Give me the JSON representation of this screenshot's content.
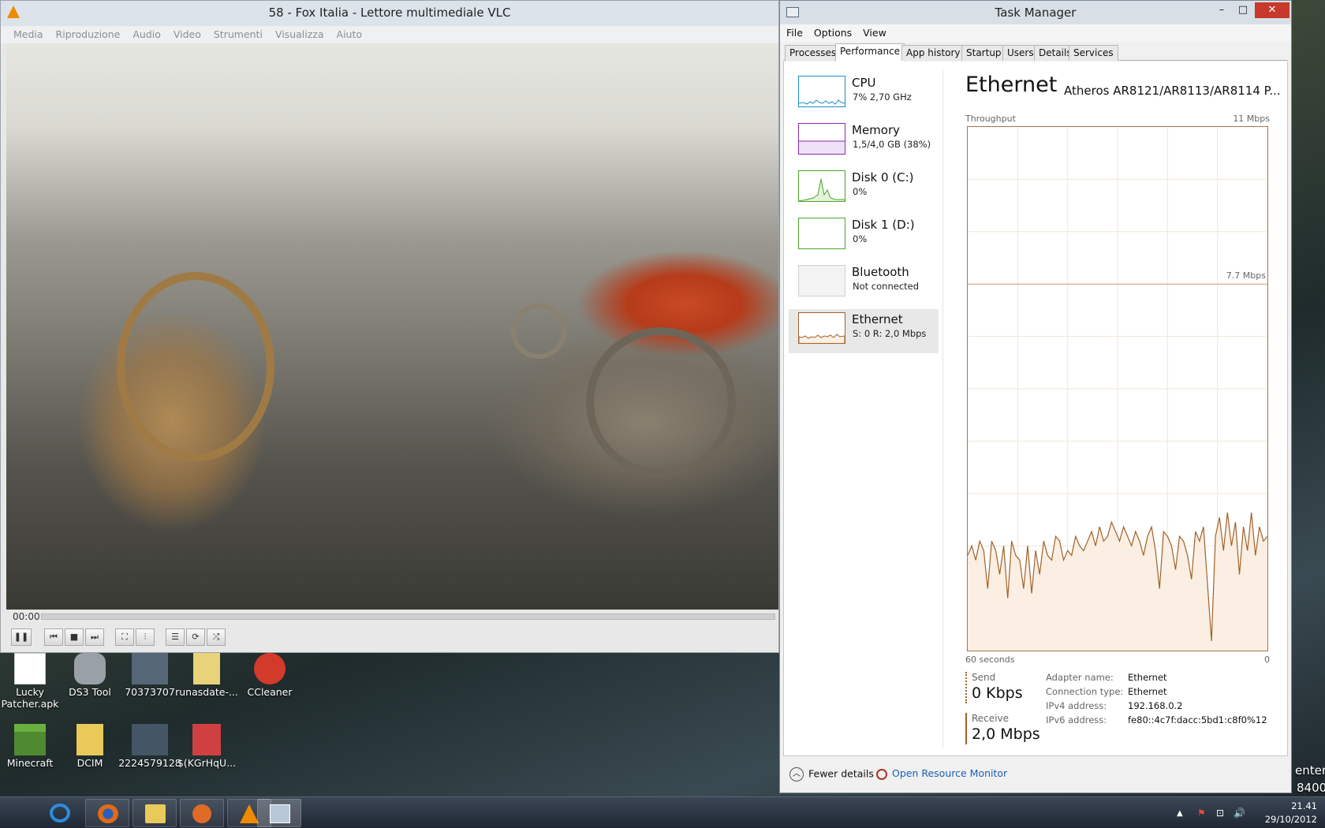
{
  "vlc": {
    "title": "58 -  Fox Italia - Lettore multimediale VLC",
    "menu": [
      "Media",
      "Riproduzione",
      "Audio",
      "Video",
      "Strumenti",
      "Visualizza",
      "Aiuto"
    ],
    "time": "00:00",
    "progress": 0,
    "controls": [
      {
        "name": "pause",
        "glyph": "❚❚"
      },
      {
        "name": "previous",
        "glyph": "⏮"
      },
      {
        "name": "stop",
        "glyph": "■"
      },
      {
        "name": "next",
        "glyph": "⏭"
      },
      {
        "name": "fullscreen",
        "glyph": "⛶"
      },
      {
        "name": "extended-settings",
        "glyph": "⫶"
      },
      {
        "name": "playlist",
        "glyph": "☰"
      },
      {
        "name": "loop",
        "glyph": "⟳"
      },
      {
        "name": "shuffle",
        "glyph": "⤮"
      }
    ]
  },
  "taskmanager": {
    "title": "Task Manager",
    "window_buttons": {
      "minimize": "–",
      "maximize": "□",
      "close": "✕"
    },
    "menu": [
      "File",
      "Options",
      "View"
    ],
    "tabs": [
      "Processes",
      "Performance",
      "App history",
      "Startup",
      "Users",
      "Details",
      "Services"
    ],
    "active_tab": "Performance",
    "sidebar": [
      {
        "name": "CPU",
        "sub": "7%  2,70 GHz",
        "color": "#1c8ec8"
      },
      {
        "name": "Memory",
        "sub": "1,5/4,0 GB (38%)",
        "color": "#8b2ab0"
      },
      {
        "name": "Disk 0 (C:)",
        "sub": "0%",
        "color": "#4da62c"
      },
      {
        "name": "Disk 1 (D:)",
        "sub": "0%",
        "color": "#4da62c"
      },
      {
        "name": "Bluetooth",
        "sub": "Not connected",
        "color": "#aaaaaa"
      },
      {
        "name": "Ethernet",
        "sub": "S: 0  R: 2,0 Mbps",
        "color": "#a0622a"
      }
    ],
    "selected": "Ethernet",
    "detail": {
      "title": "Ethernet",
      "adapter": "Atheros AR8121/AR8113/AR8114 P...",
      "throughput_label": "Throughput",
      "max_label": "11 Mbps",
      "mid_label": "7.7 Mbps",
      "time_left": "60 seconds",
      "time_right": "0",
      "send_label": "Send",
      "send_value": "0 Kbps",
      "receive_label": "Receive",
      "receive_value": "2,0 Mbps",
      "info": [
        {
          "k": "Adapter name:",
          "v": "Ethernet"
        },
        {
          "k": "Connection type:",
          "v": "Ethernet"
        },
        {
          "k": "IPv4 address:",
          "v": "192.168.0.2"
        },
        {
          "k": "IPv6 address:",
          "v": "fe80::4c7f:dacc:5bd1:c8f0%12"
        }
      ]
    },
    "graph": {
      "ymax": 11,
      "color": "#a0622a",
      "fill": "#fbeee2",
      "receive_mbps": [
        2.0,
        2.2,
        1.9,
        2.3,
        2.1,
        1.3,
        2.3,
        2.1,
        1.6,
        2.2,
        1.1,
        2.3,
        2.0,
        1.9,
        1.3,
        2.2,
        1.2,
        2.1,
        1.6,
        2.3,
        2.0,
        1.9,
        2.4,
        2.3,
        1.9,
        2.1,
        2.0,
        2.4,
        2.2,
        2.1,
        2.3,
        2.5,
        2.2,
        2.6,
        2.3,
        2.4,
        2.7,
        2.5,
        2.3,
        2.6,
        2.4,
        2.2,
        2.5,
        2.3,
        2.0,
        2.4,
        2.6,
        2.1,
        1.3,
        2.5,
        2.4,
        2.2,
        1.7,
        2.4,
        2.3,
        2.0,
        1.5,
        2.5,
        2.3,
        2.6,
        1.4,
        0.2,
        2.4,
        2.8,
        2.1,
        2.9,
        2.2,
        2.7,
        1.6,
        2.6,
        2.1,
        2.9,
        2.0,
        2.6,
        2.3,
        2.4
      ]
    },
    "footer": {
      "fewer": "Fewer details",
      "resource_monitor": "Open Resource Monitor"
    }
  },
  "desktop_icons": [
    {
      "label": "Lucky Patcher.apk",
      "icon": "document-icon",
      "color": "#ffffff"
    },
    {
      "label": "DS3 Tool",
      "icon": "gamepad-icon",
      "color": "#9aa0a8"
    },
    {
      "label": "70373707",
      "icon": "image-icon",
      "color": "#556677"
    },
    {
      "label": "runasdate-...",
      "icon": "archive-icon",
      "color": "#e8d27a"
    },
    {
      "label": "CCleaner",
      "icon": "ccleaner-icon",
      "color": "#d23a2a"
    },
    {
      "label": "Minecraft",
      "icon": "minecraft-icon",
      "color": "#4f8a30"
    },
    {
      "label": "DCIM",
      "icon": "folder-icon",
      "color": "#e8c95a"
    },
    {
      "label": "2224579128",
      "icon": "image-icon",
      "color": "#445566"
    },
    {
      "label": "$(KGrHqU...",
      "icon": "document-icon",
      "color": "#d04040"
    }
  ],
  "edge_text": [
    "enter",
    "8400"
  ],
  "taskbar": {
    "buttons": [
      {
        "name": "internet-explorer",
        "icon": "ie-icon",
        "color": "#2a8de0"
      },
      {
        "name": "firefox",
        "icon": "firefox-icon",
        "color": "#e06a1a"
      },
      {
        "name": "explorer",
        "icon": "folder-icon",
        "color": "#e8c95a"
      },
      {
        "name": "app-orange",
        "icon": "pin-icon",
        "color": "#e06a28"
      },
      {
        "name": "vlc",
        "icon": "vlc-icon",
        "color": "#f08a00"
      },
      {
        "name": "task-manager",
        "icon": "taskmanager-icon",
        "color": "#b8c8d8"
      }
    ],
    "tray": [
      "▲",
      "⚑",
      "⊡",
      "🔊"
    ],
    "time": "21.41",
    "date": "29/10/2012"
  }
}
